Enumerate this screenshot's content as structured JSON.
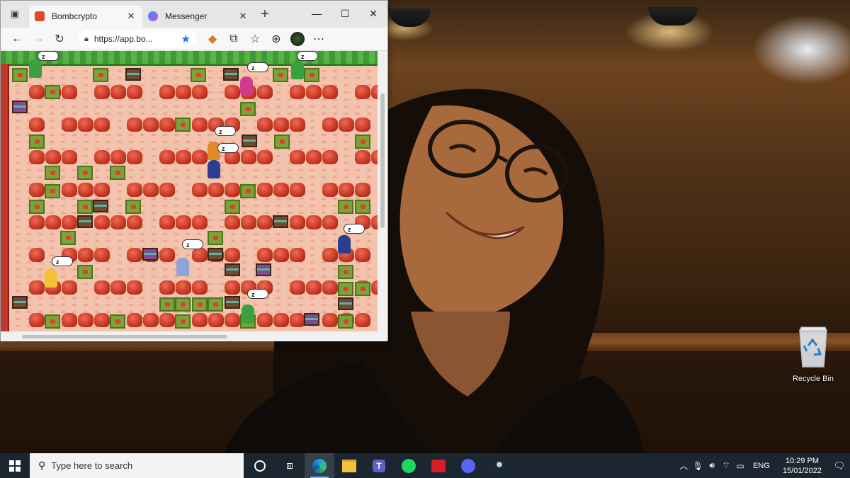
{
  "browser": {
    "tabs": [
      {
        "title": "Bombcrypto",
        "favicon_color": "#e0482a",
        "active": true
      },
      {
        "title": "Messenger",
        "favicon_color": "#a155f4",
        "active": false
      }
    ],
    "new_tab": "+",
    "window_controls": {
      "minimize": "—",
      "maximize": "☐",
      "close": "✕"
    },
    "toolbar": {
      "back": "←",
      "forward": "→",
      "refresh": "↻",
      "url": "https://app.bo...",
      "more": "⋯"
    }
  },
  "desktop": {
    "recycle_bin_label": "Recycle Bin"
  },
  "taskbar": {
    "search_placeholder": "Type here to search",
    "apps": [
      "task-view",
      "edge",
      "file-explorer",
      "teams",
      "spotify",
      "garena",
      "discord",
      "steam"
    ],
    "tray": {
      "language": "ENG",
      "time": "10:29 PM",
      "date": "15/01/2022"
    }
  },
  "game": {
    "sleep_bubble_text": "z",
    "colors": {
      "floor": "#f3c3ad",
      "rock": "#c63623",
      "crate": "#7aa33a",
      "grass": "#3f9a34"
    }
  }
}
